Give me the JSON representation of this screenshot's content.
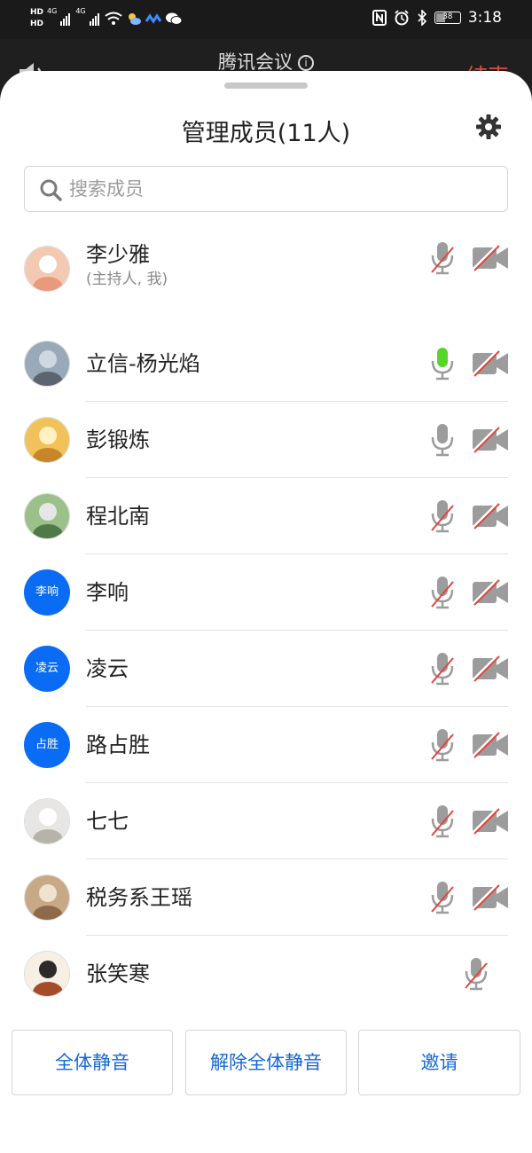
{
  "status_bar": {
    "hd_top": "HD",
    "hd_bottom": "HD",
    "net1": "4G",
    "net2": "4G",
    "battery": "38",
    "time": "3:18"
  },
  "call_header": {
    "title": "腾讯会议",
    "end_label": "结束"
  },
  "panel": {
    "title": "管理成员(11人)",
    "search_placeholder": "搜索成员"
  },
  "members": [
    {
      "name": "李少雅",
      "subtitle": "(主持人, 我)",
      "avatar": "photo",
      "mic": "muted",
      "camera": "off"
    },
    {
      "name": "立信-杨光焰",
      "avatar": "photo",
      "mic": "speaking",
      "camera": "off"
    },
    {
      "name": "彭锻炼",
      "avatar": "photo",
      "mic": "on",
      "camera": "off"
    },
    {
      "name": "程北南",
      "avatar": "photo",
      "mic": "muted",
      "camera": "off"
    },
    {
      "name": "李响",
      "avatar_text": "李响",
      "avatar": "initials",
      "mic": "muted",
      "camera": "off"
    },
    {
      "name": "凌云",
      "avatar_text": "凌云",
      "avatar": "initials",
      "mic": "muted",
      "camera": "off"
    },
    {
      "name": "路占胜",
      "avatar_text": "占胜",
      "avatar": "initials",
      "mic": "muted",
      "camera": "off"
    },
    {
      "name": "七七",
      "avatar": "photo",
      "mic": "muted",
      "camera": "off"
    },
    {
      "name": "税务系王瑶",
      "avatar": "photo",
      "mic": "muted",
      "camera": "off"
    },
    {
      "name": "张笑寒",
      "avatar": "photo",
      "mic": "muted",
      "camera": "none"
    }
  ],
  "actions": {
    "mute_all": "全体静音",
    "unmute_all": "解除全体静音",
    "invite": "邀请"
  },
  "colors": {
    "accent_blue": "#0a6cf5",
    "button_text": "#1468d8",
    "muted_slash": "#e0463c",
    "speaking_green": "#57d62a",
    "end_red": "#e04a3f"
  }
}
